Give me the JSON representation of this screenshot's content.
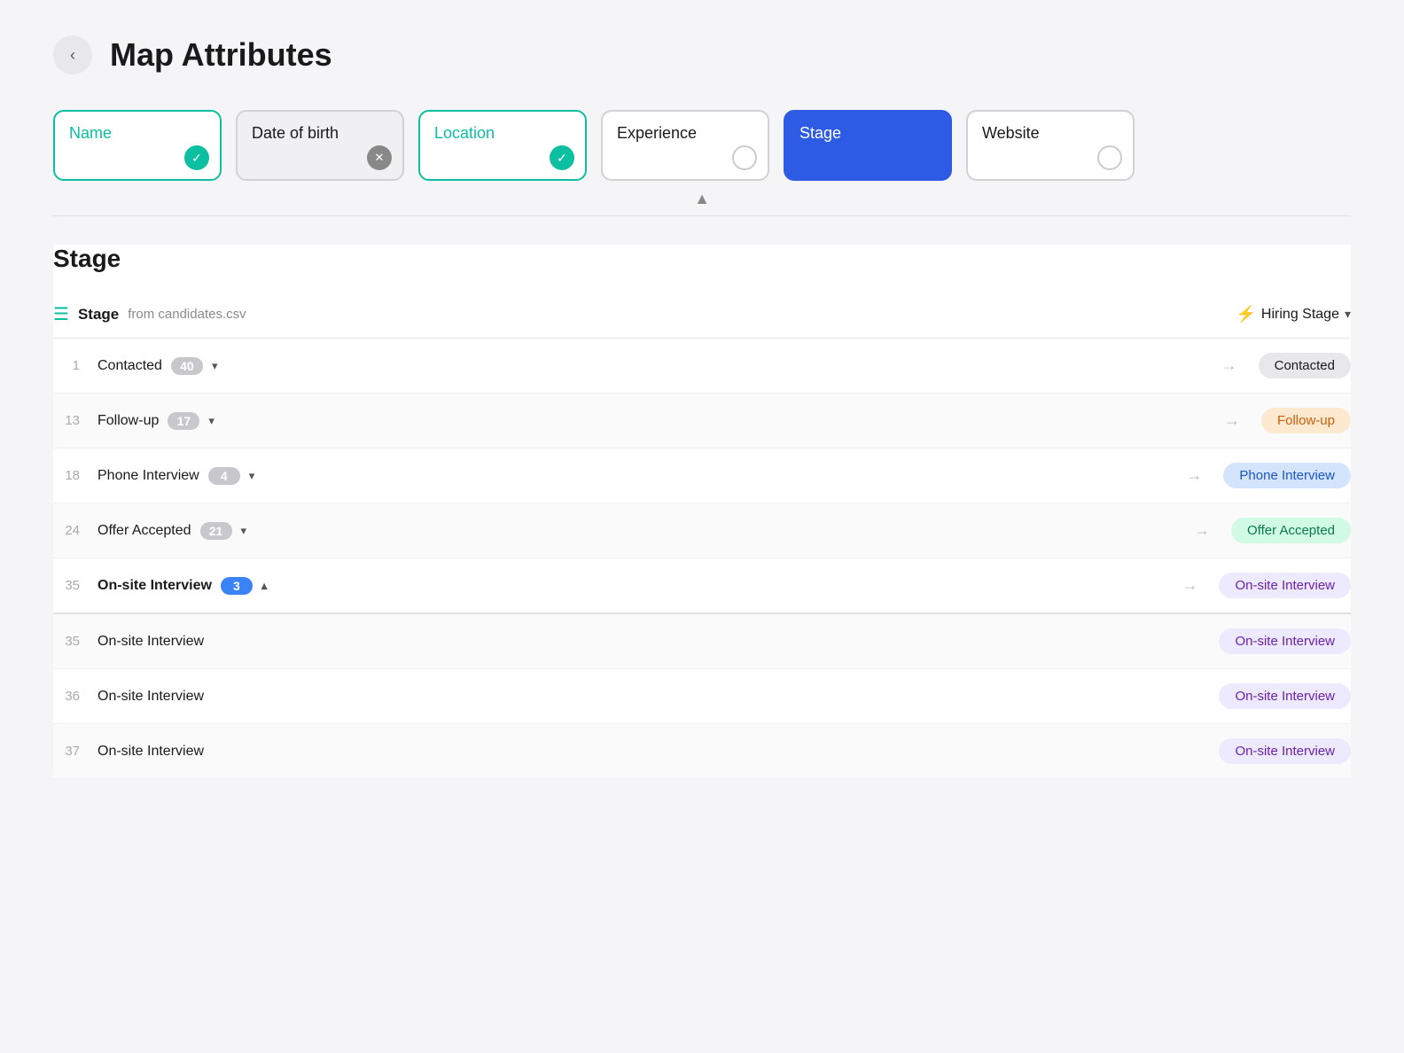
{
  "header": {
    "back_label": "‹",
    "title": "Map Attributes"
  },
  "attributes": [
    {
      "id": "name",
      "label": "Name",
      "state": "teal",
      "icon": "check"
    },
    {
      "id": "dob",
      "label": "Date of birth",
      "state": "disabled",
      "icon": "x"
    },
    {
      "id": "location",
      "label": "Location",
      "state": "teal",
      "icon": "check"
    },
    {
      "id": "experience",
      "label": "Experience",
      "state": "default",
      "icon": "empty"
    },
    {
      "id": "stage",
      "label": "Stage",
      "state": "active-blue",
      "icon": "none"
    },
    {
      "id": "website",
      "label": "Website",
      "state": "default",
      "icon": "empty"
    }
  ],
  "stage_section": {
    "heading": "Stage",
    "source_icon": "list-icon",
    "source_label": "Stage",
    "source_from": "from candidates.csv",
    "target_icon": "bolt-icon",
    "target_label": "Hiring Stage",
    "rows": [
      {
        "num": "1",
        "name": "Contacted",
        "count": 40,
        "badge": "gray",
        "caret": "down",
        "tag_label": "Contacted",
        "tag_style": "gray"
      },
      {
        "num": "13",
        "name": "Follow-up",
        "count": 17,
        "badge": "gray",
        "caret": "down",
        "tag_label": "Follow-up",
        "tag_style": "orange"
      },
      {
        "num": "18",
        "name": "Phone Interview",
        "count": 4,
        "badge": "gray",
        "caret": "down",
        "tag_label": "Phone Interview",
        "tag_style": "blue"
      },
      {
        "num": "24",
        "name": "Offer Accepted",
        "count": 21,
        "badge": "gray",
        "caret": "down",
        "tag_label": "Offer Accepted",
        "tag_style": "green"
      },
      {
        "num": "35",
        "name": "On-site Interview",
        "count": 3,
        "badge": "blue",
        "caret": "up",
        "tag_label": "On-site Interview",
        "tag_style": "purple"
      },
      {
        "num": "35",
        "name": "On-site Interview",
        "count": null,
        "badge": null,
        "caret": null,
        "tag_label": "On-site Interview",
        "tag_style": "purple",
        "sub": true
      },
      {
        "num": "36",
        "name": "On-site Interview",
        "count": null,
        "badge": null,
        "caret": null,
        "tag_label": "On-site Interview",
        "tag_style": "purple",
        "sub": true
      },
      {
        "num": "37",
        "name": "On-site Interview",
        "count": null,
        "badge": null,
        "caret": null,
        "tag_label": "On-site Interview",
        "tag_style": "purple",
        "sub": true
      }
    ]
  }
}
